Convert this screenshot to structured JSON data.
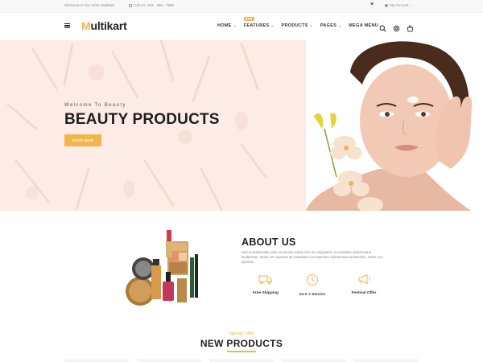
{
  "topbar": {
    "welcome": "Welcome to Our store Multikart",
    "call": "Call Us: 123 - 456 - 7890",
    "account": "My Account"
  },
  "header": {
    "logo_first": "M",
    "logo_rest": "ultikart",
    "nav": [
      {
        "label": "HOME",
        "badge": ""
      },
      {
        "label": "FEATURES",
        "badge": "NEW"
      },
      {
        "label": "PRODUCTS",
        "badge": ""
      },
      {
        "label": "PAGES",
        "badge": ""
      },
      {
        "label": "MEGA MENU",
        "badge": ""
      }
    ],
    "icons": [
      "search-icon",
      "settings-icon",
      "cart-icon"
    ]
  },
  "hero": {
    "welcome": "Welcome To Beauty",
    "title": "BEAUTY PRODUCTS",
    "button": "SHOP NOW",
    "background": "#fcece5"
  },
  "about": {
    "title": "ABOUT US",
    "text": "Sed ut perspiciatis unde omnis iste natus error sit voluptatem accusantium doloremque laudantium, totam rem aperiam sit voluptatem accusantium doloremque laudantium, totam rem aperiam.",
    "features": [
      {
        "icon": "truck-icon",
        "label": "Free Shipping"
      },
      {
        "icon": "clock-icon",
        "label": "24 X 7 Service"
      },
      {
        "icon": "megaphone-icon",
        "label": "Festival Offer"
      }
    ]
  },
  "new_products": {
    "kicker": "Special Offer",
    "title": "NEW PRODUCTS"
  },
  "colors": {
    "accent": "#f0b54d",
    "text_dark": "#222222",
    "hero_bg": "#fcece5"
  }
}
